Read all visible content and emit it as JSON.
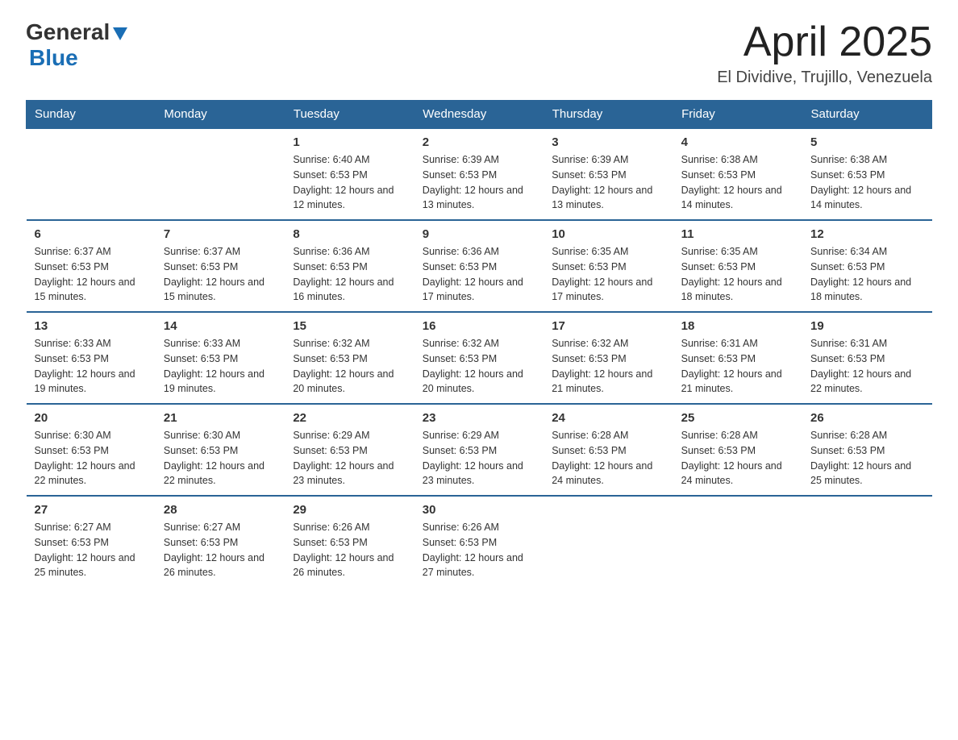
{
  "logo": {
    "general": "General",
    "blue": "Blue"
  },
  "title": "April 2025",
  "subtitle": "El Dividive, Trujillo, Venezuela",
  "headers": [
    "Sunday",
    "Monday",
    "Tuesday",
    "Wednesday",
    "Thursday",
    "Friday",
    "Saturday"
  ],
  "weeks": [
    [
      {
        "day": "",
        "sunrise": "",
        "sunset": "",
        "daylight": ""
      },
      {
        "day": "",
        "sunrise": "",
        "sunset": "",
        "daylight": ""
      },
      {
        "day": "1",
        "sunrise": "Sunrise: 6:40 AM",
        "sunset": "Sunset: 6:53 PM",
        "daylight": "Daylight: 12 hours and 12 minutes."
      },
      {
        "day": "2",
        "sunrise": "Sunrise: 6:39 AM",
        "sunset": "Sunset: 6:53 PM",
        "daylight": "Daylight: 12 hours and 13 minutes."
      },
      {
        "day": "3",
        "sunrise": "Sunrise: 6:39 AM",
        "sunset": "Sunset: 6:53 PM",
        "daylight": "Daylight: 12 hours and 13 minutes."
      },
      {
        "day": "4",
        "sunrise": "Sunrise: 6:38 AM",
        "sunset": "Sunset: 6:53 PM",
        "daylight": "Daylight: 12 hours and 14 minutes."
      },
      {
        "day": "5",
        "sunrise": "Sunrise: 6:38 AM",
        "sunset": "Sunset: 6:53 PM",
        "daylight": "Daylight: 12 hours and 14 minutes."
      }
    ],
    [
      {
        "day": "6",
        "sunrise": "Sunrise: 6:37 AM",
        "sunset": "Sunset: 6:53 PM",
        "daylight": "Daylight: 12 hours and 15 minutes."
      },
      {
        "day": "7",
        "sunrise": "Sunrise: 6:37 AM",
        "sunset": "Sunset: 6:53 PM",
        "daylight": "Daylight: 12 hours and 15 minutes."
      },
      {
        "day": "8",
        "sunrise": "Sunrise: 6:36 AM",
        "sunset": "Sunset: 6:53 PM",
        "daylight": "Daylight: 12 hours and 16 minutes."
      },
      {
        "day": "9",
        "sunrise": "Sunrise: 6:36 AM",
        "sunset": "Sunset: 6:53 PM",
        "daylight": "Daylight: 12 hours and 17 minutes."
      },
      {
        "day": "10",
        "sunrise": "Sunrise: 6:35 AM",
        "sunset": "Sunset: 6:53 PM",
        "daylight": "Daylight: 12 hours and 17 minutes."
      },
      {
        "day": "11",
        "sunrise": "Sunrise: 6:35 AM",
        "sunset": "Sunset: 6:53 PM",
        "daylight": "Daylight: 12 hours and 18 minutes."
      },
      {
        "day": "12",
        "sunrise": "Sunrise: 6:34 AM",
        "sunset": "Sunset: 6:53 PM",
        "daylight": "Daylight: 12 hours and 18 minutes."
      }
    ],
    [
      {
        "day": "13",
        "sunrise": "Sunrise: 6:33 AM",
        "sunset": "Sunset: 6:53 PM",
        "daylight": "Daylight: 12 hours and 19 minutes."
      },
      {
        "day": "14",
        "sunrise": "Sunrise: 6:33 AM",
        "sunset": "Sunset: 6:53 PM",
        "daylight": "Daylight: 12 hours and 19 minutes."
      },
      {
        "day": "15",
        "sunrise": "Sunrise: 6:32 AM",
        "sunset": "Sunset: 6:53 PM",
        "daylight": "Daylight: 12 hours and 20 minutes."
      },
      {
        "day": "16",
        "sunrise": "Sunrise: 6:32 AM",
        "sunset": "Sunset: 6:53 PM",
        "daylight": "Daylight: 12 hours and 20 minutes."
      },
      {
        "day": "17",
        "sunrise": "Sunrise: 6:32 AM",
        "sunset": "Sunset: 6:53 PM",
        "daylight": "Daylight: 12 hours and 21 minutes."
      },
      {
        "day": "18",
        "sunrise": "Sunrise: 6:31 AM",
        "sunset": "Sunset: 6:53 PM",
        "daylight": "Daylight: 12 hours and 21 minutes."
      },
      {
        "day": "19",
        "sunrise": "Sunrise: 6:31 AM",
        "sunset": "Sunset: 6:53 PM",
        "daylight": "Daylight: 12 hours and 22 minutes."
      }
    ],
    [
      {
        "day": "20",
        "sunrise": "Sunrise: 6:30 AM",
        "sunset": "Sunset: 6:53 PM",
        "daylight": "Daylight: 12 hours and 22 minutes."
      },
      {
        "day": "21",
        "sunrise": "Sunrise: 6:30 AM",
        "sunset": "Sunset: 6:53 PM",
        "daylight": "Daylight: 12 hours and 22 minutes."
      },
      {
        "day": "22",
        "sunrise": "Sunrise: 6:29 AM",
        "sunset": "Sunset: 6:53 PM",
        "daylight": "Daylight: 12 hours and 23 minutes."
      },
      {
        "day": "23",
        "sunrise": "Sunrise: 6:29 AM",
        "sunset": "Sunset: 6:53 PM",
        "daylight": "Daylight: 12 hours and 23 minutes."
      },
      {
        "day": "24",
        "sunrise": "Sunrise: 6:28 AM",
        "sunset": "Sunset: 6:53 PM",
        "daylight": "Daylight: 12 hours and 24 minutes."
      },
      {
        "day": "25",
        "sunrise": "Sunrise: 6:28 AM",
        "sunset": "Sunset: 6:53 PM",
        "daylight": "Daylight: 12 hours and 24 minutes."
      },
      {
        "day": "26",
        "sunrise": "Sunrise: 6:28 AM",
        "sunset": "Sunset: 6:53 PM",
        "daylight": "Daylight: 12 hours and 25 minutes."
      }
    ],
    [
      {
        "day": "27",
        "sunrise": "Sunrise: 6:27 AM",
        "sunset": "Sunset: 6:53 PM",
        "daylight": "Daylight: 12 hours and 25 minutes."
      },
      {
        "day": "28",
        "sunrise": "Sunrise: 6:27 AM",
        "sunset": "Sunset: 6:53 PM",
        "daylight": "Daylight: 12 hours and 26 minutes."
      },
      {
        "day": "29",
        "sunrise": "Sunrise: 6:26 AM",
        "sunset": "Sunset: 6:53 PM",
        "daylight": "Daylight: 12 hours and 26 minutes."
      },
      {
        "day": "30",
        "sunrise": "Sunrise: 6:26 AM",
        "sunset": "Sunset: 6:53 PM",
        "daylight": "Daylight: 12 hours and 27 minutes."
      },
      {
        "day": "",
        "sunrise": "",
        "sunset": "",
        "daylight": ""
      },
      {
        "day": "",
        "sunrise": "",
        "sunset": "",
        "daylight": ""
      },
      {
        "day": "",
        "sunrise": "",
        "sunset": "",
        "daylight": ""
      }
    ]
  ]
}
